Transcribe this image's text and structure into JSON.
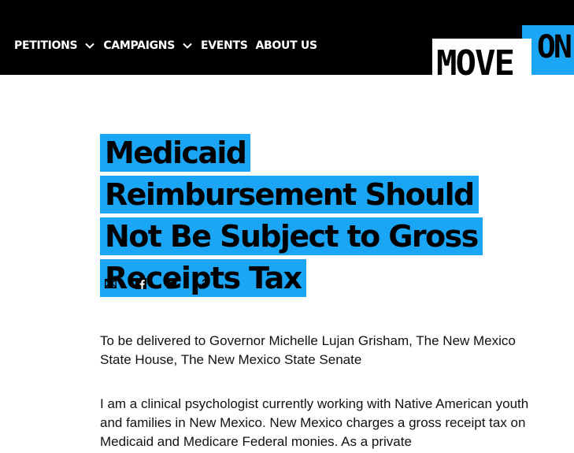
{
  "nav": {
    "items": [
      {
        "label": "PETITIONS",
        "has_dropdown": true
      },
      {
        "label": "CAMPAIGNS",
        "has_dropdown": true
      },
      {
        "label": "EVENTS",
        "has_dropdown": false
      },
      {
        "label": "ABOUT US",
        "has_dropdown": false
      }
    ]
  },
  "logo": {
    "move": "MOVE",
    "on": "ON",
    "accent_color": "#1ba5f5"
  },
  "petition": {
    "title": "Medicaid Reimbursement Should Not Be Subject to Gross Receipts Tax",
    "delivered_to": "To be delivered to Governor Michelle Lujan Grisham, The New Mexico State House, The New Mexico State Senate",
    "body": "I am a clinical psychologist currently working with Native American youth and families in New Mexico. New Mexico charges a gross receipt tax on Medicaid and Medicare Federal monies. As a private"
  },
  "share": {
    "icons": [
      "email-icon",
      "facebook-icon",
      "twitter-icon",
      "link-icon"
    ]
  },
  "colors": {
    "header_bg": "#000000",
    "highlight": "#1ba5f5"
  }
}
